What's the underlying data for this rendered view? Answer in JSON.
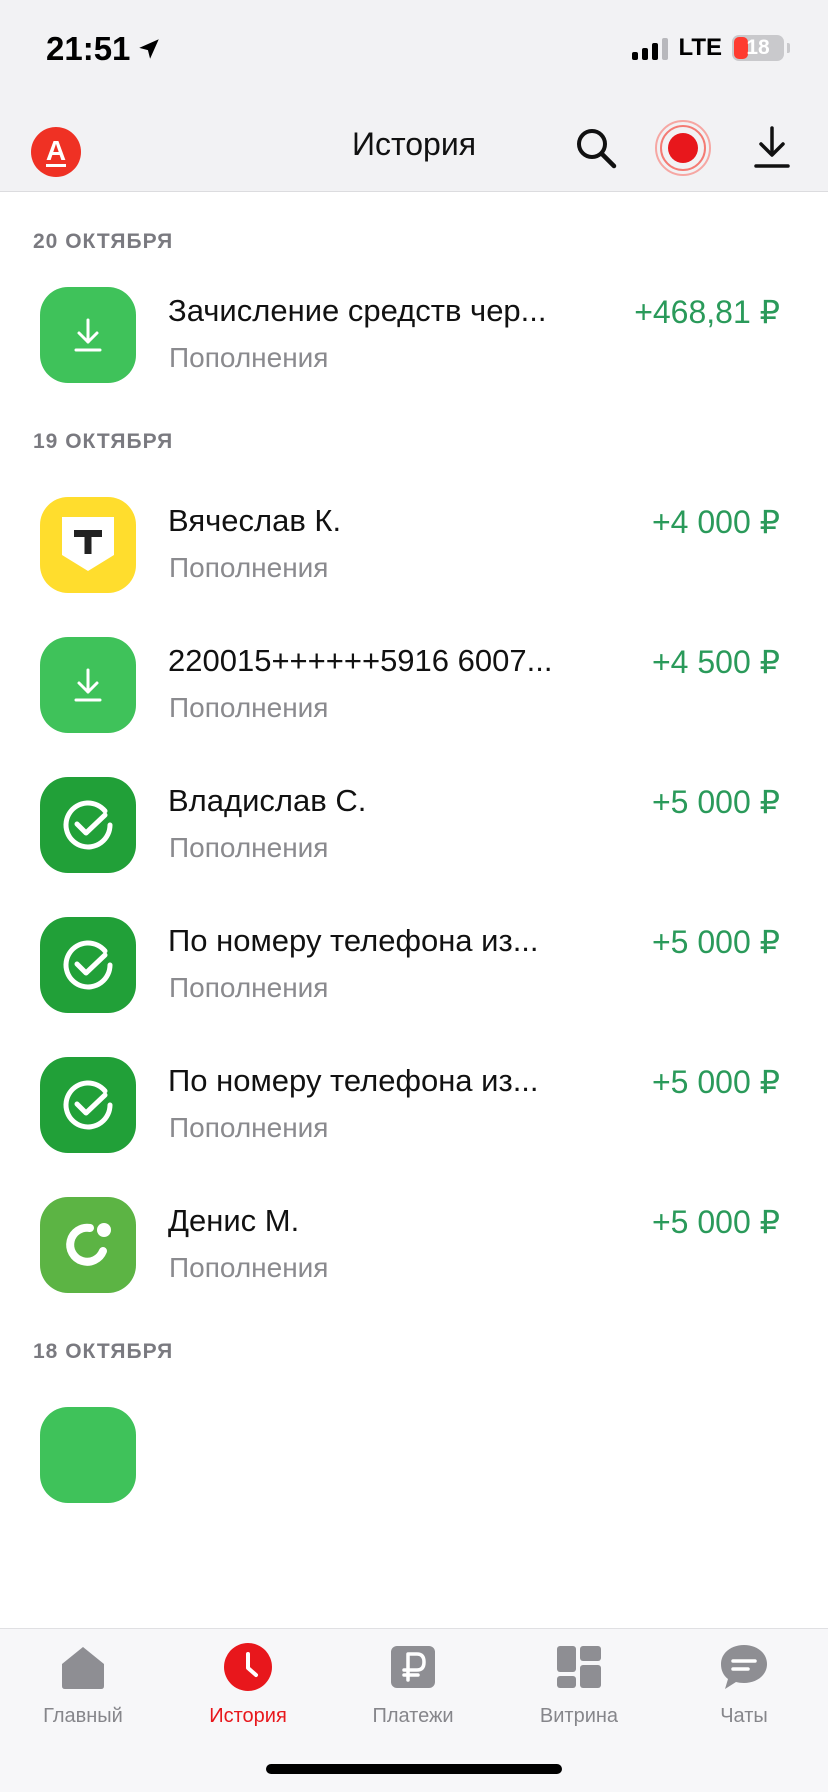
{
  "status_bar": {
    "time": "21:51",
    "network": "LTE",
    "battery": "18"
  },
  "header": {
    "title": "История",
    "logo_letter": "А"
  },
  "sections": [
    {
      "date": "20 ОКТЯБРЯ"
    },
    {
      "date": "19 ОКТЯБРЯ"
    },
    {
      "date": "18 ОКТЯБРЯ"
    }
  ],
  "transactions": [
    {
      "title": "Зачисление средств чер...",
      "category": "Пополнения",
      "amount": "+468,81 ₽",
      "icon": "download-icon"
    },
    {
      "title": "Вячеслав К.",
      "category": "Пополнения",
      "amount": "+4 000 ₽",
      "icon": "tbank-shield-icon"
    },
    {
      "title": "220015++++++5916 6007...",
      "category": "Пополнения",
      "amount": "+4 500 ₽",
      "icon": "download-icon"
    },
    {
      "title": "Владислав С.",
      "category": "Пополнения",
      "amount": "+5 000 ₽",
      "icon": "sber-check-icon"
    },
    {
      "title": "По номеру телефона из...",
      "category": "Пополнения",
      "amount": "+5 000 ₽",
      "icon": "sber-check-icon"
    },
    {
      "title": "По номеру телефона из...",
      "category": "Пополнения",
      "amount": "+5 000 ₽",
      "icon": "sber-check-icon"
    },
    {
      "title": "Денис М.",
      "category": "Пополнения",
      "amount": "+5 000 ₽",
      "icon": "ozon-ring-icon"
    }
  ],
  "tabs": [
    {
      "label": "Главный",
      "icon": "home-icon"
    },
    {
      "label": "История",
      "icon": "clock-icon",
      "active": true
    },
    {
      "label": "Платежи",
      "icon": "ruble-icon"
    },
    {
      "label": "Витрина",
      "icon": "grid-icon"
    },
    {
      "label": "Чаты",
      "icon": "chat-icon"
    }
  ],
  "colors": {
    "accent": "#e8171c",
    "amount_positive": "#2a9a5a",
    "tile_light_green": "#3fc25a",
    "tile_sber_green": "#21a038",
    "tile_tbank_yellow": "#ffdd2d",
    "tile_ozon_green": "#5cb444"
  }
}
